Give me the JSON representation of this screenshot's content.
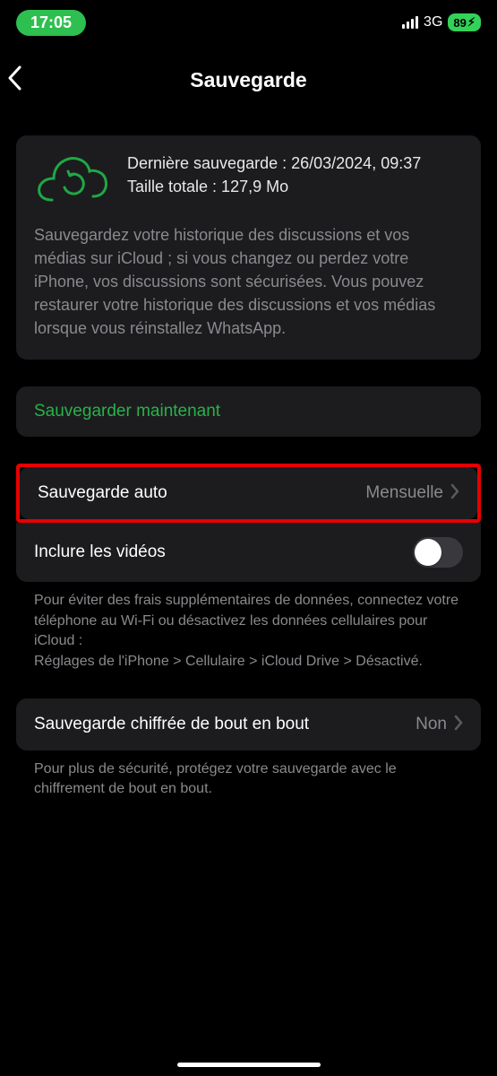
{
  "status": {
    "time": "17:05",
    "network_label": "3G",
    "battery_percent": "89"
  },
  "nav": {
    "title": "Sauvegarde"
  },
  "info": {
    "last_backup": "Dernière sauvegarde : 26/03/2024, 09:37",
    "total_size": "Taille totale : 127,9 Mo",
    "description": "Sauvegardez votre historique des discussions et vos médias sur iCloud ; si vous changez ou perdez votre iPhone, vos discussions sont sécurisées. Vous pouvez restaurer votre historique des discussions et vos médias lorsque vous réinstallez WhatsApp."
  },
  "actions": {
    "backup_now": "Sauvegarder maintenant"
  },
  "settings": {
    "auto_backup": {
      "label": "Sauvegarde auto",
      "value": "Mensuelle"
    },
    "include_videos": {
      "label": "Inclure les vidéos",
      "enabled": false
    },
    "footer_hint": "Pour éviter des frais supplémentaires de données, connectez votre téléphone au Wi-Fi ou désactivez les données cellulaires pour iCloud :\nRéglages de l'iPhone > Cellulaire > iCloud Drive > Désactivé.",
    "e2e": {
      "label": "Sauvegarde chiffrée de bout en bout",
      "value": "Non"
    },
    "e2e_hint": "Pour plus de sécurité, protégez votre sauvegarde avec le chiffrement de bout en bout."
  }
}
